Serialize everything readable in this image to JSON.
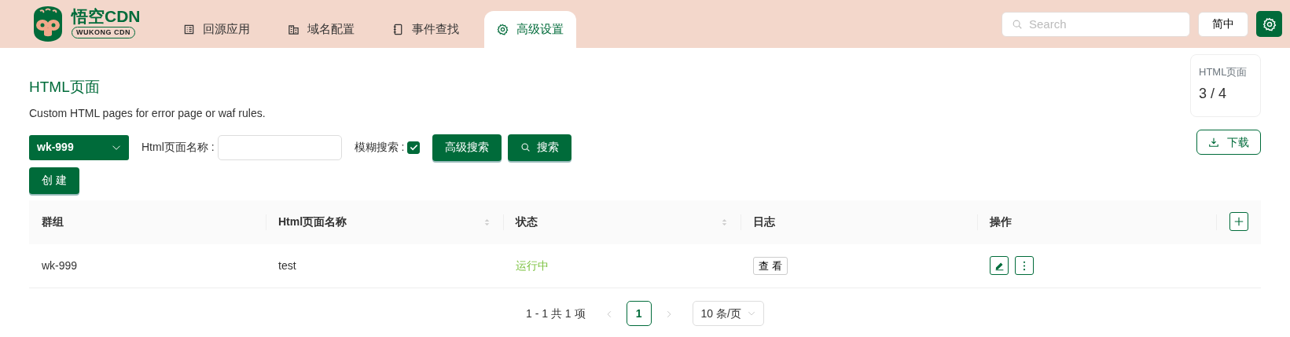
{
  "header": {
    "logo": {
      "title": "悟空CDN",
      "subtitle": "WUKONG CDN"
    },
    "tabs": [
      {
        "label": "回源应用",
        "selected": false
      },
      {
        "label": "域名配置",
        "selected": false
      },
      {
        "label": "事件查找",
        "selected": false
      },
      {
        "label": "高级设置",
        "selected": true
      }
    ],
    "search": {
      "placeholder": "Search"
    },
    "language_button": "简中"
  },
  "page": {
    "title": "HTML页面",
    "description": "Custom HTML pages for error page or waf rules.",
    "stat": {
      "label": "HTML页面",
      "value": "3 / 4"
    },
    "download_button": "下载",
    "filters": {
      "group_select": "wk-999",
      "name_label": "Html页面名称 :",
      "fuzzy_label": "模糊搜索 :",
      "fuzzy_checked": true,
      "advanced_button": "高级搜索",
      "search_button": "搜索"
    },
    "create_button": "创 建"
  },
  "table": {
    "columns": [
      {
        "label": "群组",
        "sortable": false
      },
      {
        "label": "Html页面名称",
        "sortable": true
      },
      {
        "label": "状态",
        "sortable": true
      },
      {
        "label": "日志",
        "sortable": false
      },
      {
        "label": "操作",
        "sortable": false
      }
    ],
    "rows": [
      {
        "group": "wk-999",
        "name": "test",
        "status": "运行中",
        "color": "#7cc240",
        "log_button": "查 看"
      }
    ]
  },
  "pagination": {
    "summary": "1 - 1 共 1 项",
    "pages": [
      {
        "label": "1",
        "selected": true
      }
    ],
    "page_size": "10 条/页"
  }
}
